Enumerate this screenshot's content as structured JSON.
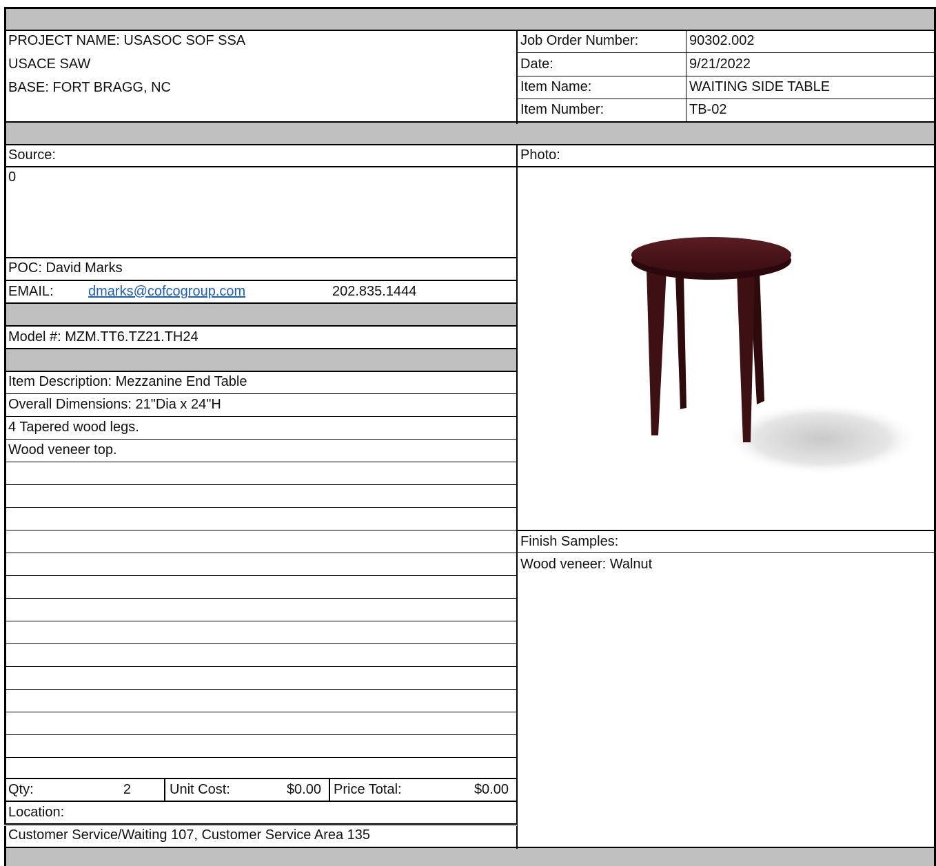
{
  "header": {
    "project_name": "PROJECT NAME: USASOC SOF SSA",
    "agency": "USACE SAW",
    "base": "BASE: FORT BRAGG, NC"
  },
  "info": {
    "job_order_label": "Job Order Number:",
    "job_order_value": "90302.002",
    "date_label": "Date:",
    "date_value": "9/21/2022",
    "item_name_label": "Item Name:",
    "item_name_value": "WAITING SIDE TABLE",
    "item_number_label": "Item Number:",
    "item_number_value": "TB-02"
  },
  "source": {
    "label": "Source:",
    "value": "0",
    "poc": "POC: David Marks",
    "email_label": "EMAIL:",
    "email": "dmarks@cofcogroup.com",
    "phone": "202.835.1444"
  },
  "model": "Model #: MZM.TT6.TZ21.TH24",
  "description": [
    "Item Description: Mezzanine End Table",
    "Overall Dimensions: 21\"Dia x 24\"H",
    "4 Tapered wood legs.",
    "Wood veneer top."
  ],
  "photo": {
    "label": "Photo:"
  },
  "finish": {
    "label": "Finish Samples:",
    "value": "Wood veneer: Walnut"
  },
  "cost": {
    "qty_label": "Qty:",
    "qty_value": "2",
    "unit_cost_label": "Unit Cost:",
    "unit_cost_value": "$0.00",
    "price_total_label": "Price Total:",
    "price_total_value": "$0.00"
  },
  "location": {
    "label": "Location:",
    "value": "Customer Service/Waiting 107, Customer Service Area 135"
  },
  "colors": {
    "band_gray": "#c0c0c0",
    "link_blue": "#1f5fb8",
    "table_wood": "#4a1418"
  }
}
